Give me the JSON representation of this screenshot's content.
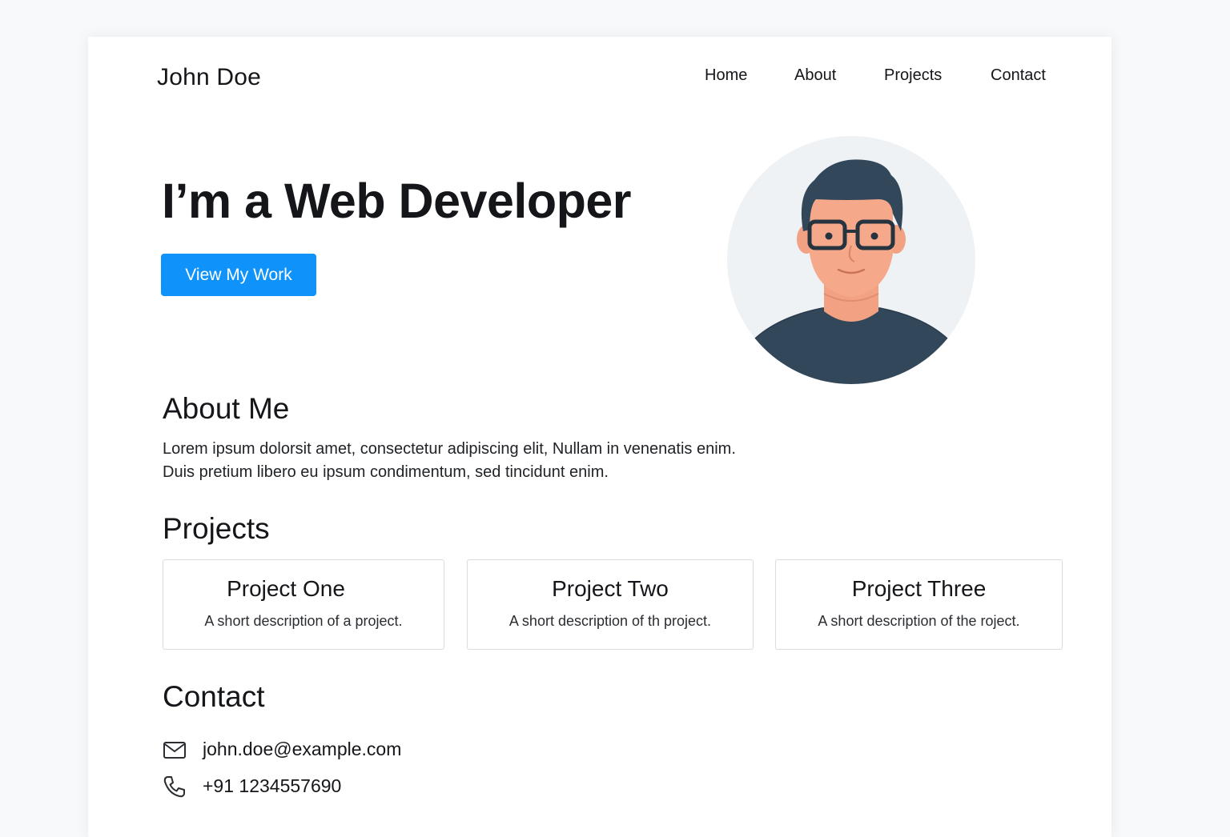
{
  "header": {
    "brand": "John Doe",
    "nav": [
      "Home",
      "About",
      "Projects",
      "Contact"
    ]
  },
  "hero": {
    "title": "I’m a Web Developer",
    "cta_label": "View My Work",
    "accent_color": "#0f93fb"
  },
  "about": {
    "heading": "About Me",
    "line1": "Lorem ipsum dolorsit amet, consectetur adipiscing elit, Nullam in venenatis enim.",
    "line2": "Duis pretium libero eu ipsum condimentum, sed tincidunt enim."
  },
  "projects": {
    "heading": "Projects",
    "items": [
      {
        "title": "Project One",
        "description": "A short description of a project."
      },
      {
        "title": "Project Two",
        "description": "A short description of th project."
      },
      {
        "title": "Project Three",
        "description": "A short description of the roject."
      }
    ]
  },
  "contact": {
    "heading": "Contact",
    "email": "john.doe@example.com",
    "phone": "+91 1234557690",
    "email_icon": "mail-icon",
    "phone_icon": "phone-icon"
  }
}
